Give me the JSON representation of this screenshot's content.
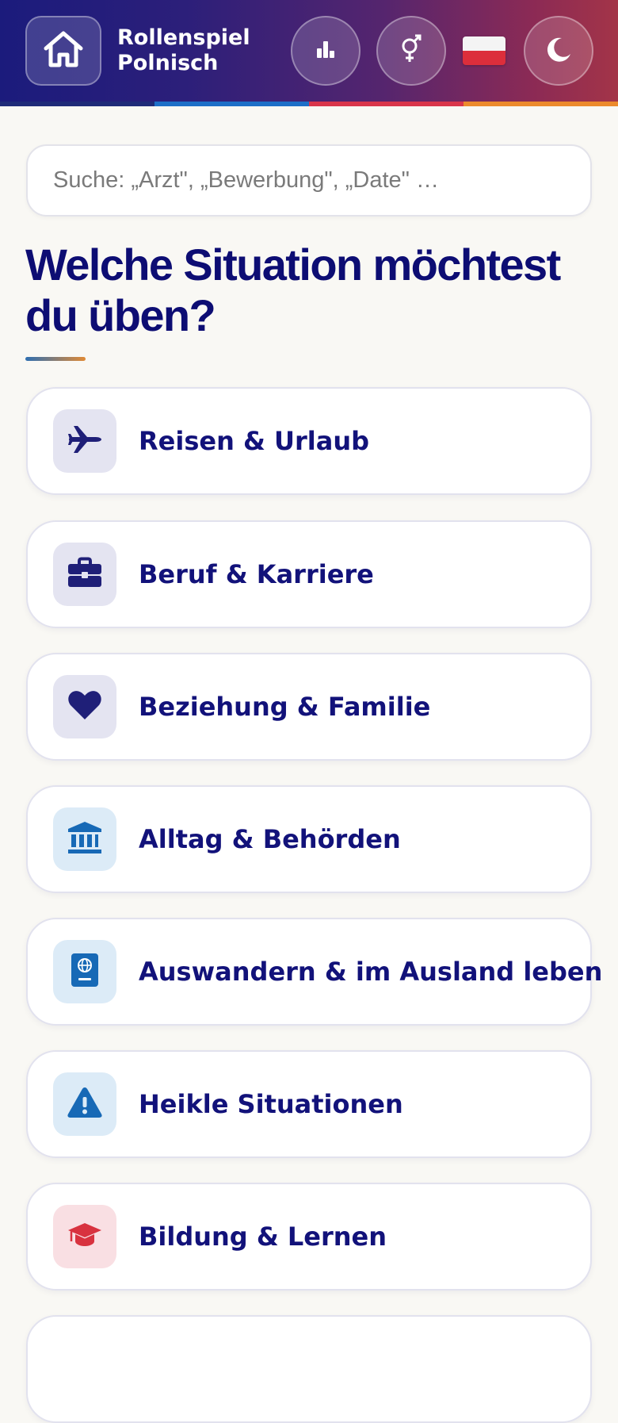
{
  "header": {
    "title_line1": "Rollenspiel",
    "title_line2": "Polnisch",
    "home_icon": "home-icon",
    "stats_icon": "bar-chart-icon",
    "gender_icon": "gender-icon",
    "language_flag": "poland-flag",
    "theme_icon": "moon-icon",
    "stripe_colors": [
      "#1f2b78",
      "#1d6fc7",
      "#d9354a",
      "#ec8a2c"
    ]
  },
  "search": {
    "placeholder": "Suche: „Arzt\", „Bewerbung\", „Date\" …",
    "value": ""
  },
  "main": {
    "heading": "Welche Situation möchtest du üben?",
    "categories": [
      {
        "label": "Reisen & Urlaub",
        "icon": "airplane-icon",
        "icon_color": "#1f1f78",
        "icon_bg": "#e4e4f1"
      },
      {
        "label": "Beruf & Karriere",
        "icon": "briefcase-icon",
        "icon_color": "#1f1f78",
        "icon_bg": "#e4e4f1"
      },
      {
        "label": "Beziehung & Familie",
        "icon": "heart-icon",
        "icon_color": "#1f1f78",
        "icon_bg": "#e4e4f1"
      },
      {
        "label": "Alltag & Behörden",
        "icon": "government-building-icon",
        "icon_color": "#1769b6",
        "icon_bg": "#dcebf7"
      },
      {
        "label": "Auswandern & im Ausland leben",
        "icon": "passport-icon",
        "icon_color": "#1769b6",
        "icon_bg": "#dcebf7"
      },
      {
        "label": "Heikle Situationen",
        "icon": "warning-icon",
        "icon_color": "#1769b6",
        "icon_bg": "#dcebf7"
      },
      {
        "label": "Bildung & Lernen",
        "icon": "graduation-cap-icon",
        "icon_color": "#d8323f",
        "icon_bg": "#f9dfe3"
      }
    ]
  }
}
